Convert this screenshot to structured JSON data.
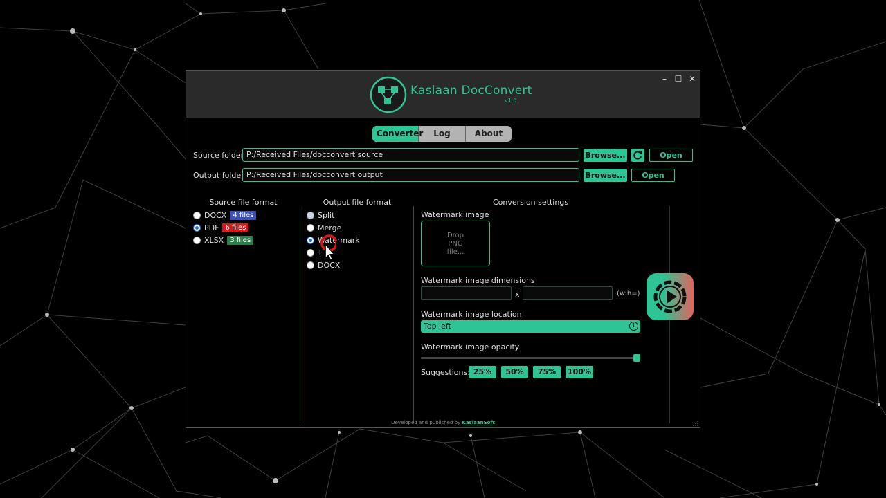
{
  "app": {
    "title": "Kaslaan DocConvert",
    "version": "v1.0"
  },
  "window_controls": {
    "minimize": "–",
    "maximize": "☐",
    "close": "✕"
  },
  "tabs": [
    {
      "label": "Converter",
      "active": true
    },
    {
      "label": "Log",
      "active": false
    },
    {
      "label": "About",
      "active": false
    }
  ],
  "folders": {
    "source_label": "Source folder",
    "source_path": "P:/Received Files/docconvert source",
    "output_label": "Output folder",
    "output_path": "P:/Received Files/docconvert output",
    "browse_label": "Browse...",
    "open_label": "Open"
  },
  "source_format": {
    "title": "Source file format",
    "options": [
      {
        "label": "DOCX",
        "badge": "4 files",
        "badge_color": "#3d4fb0",
        "checked": false
      },
      {
        "label": "PDF",
        "badge": "6 files",
        "badge_color": "#d11a1a",
        "checked": true
      },
      {
        "label": "XLSX",
        "badge": "3 files",
        "badge_color": "#2e7d4a",
        "checked": false
      }
    ]
  },
  "output_format": {
    "title": "Output file format",
    "options": [
      {
        "label": "Split",
        "checked": false,
        "disabled": true
      },
      {
        "label": "Merge",
        "checked": false,
        "disabled": false
      },
      {
        "label": "Watermark",
        "checked": true,
        "disabled": false
      },
      {
        "label": "T",
        "checked": false,
        "disabled": false
      },
      {
        "label": "DOCX",
        "checked": false,
        "disabled": false
      }
    ]
  },
  "conversion": {
    "title": "Conversion settings",
    "watermark_image_label": "Watermark image",
    "drop_text": [
      "Drop",
      "PNG",
      "file..."
    ],
    "dimensions_label": "Watermark image dimensions",
    "dimensions_sep": "x",
    "dimensions_hint": "(w:h=)",
    "location_label": "Watermark image location",
    "location_value": "Top left",
    "opacity_label": "Watermark image opacity",
    "opacity_value": 1.0,
    "suggestions_label": "Suggestions:",
    "suggestions": [
      "25%",
      "50%",
      "75%",
      "100%"
    ]
  },
  "footer": {
    "text": "Developed and published by",
    "link": "KaslaanSoft"
  },
  "colors": {
    "accent": "#2ec495",
    "titlebar": "#2a2a2a",
    "run_gradient_end": "#e0645e"
  }
}
